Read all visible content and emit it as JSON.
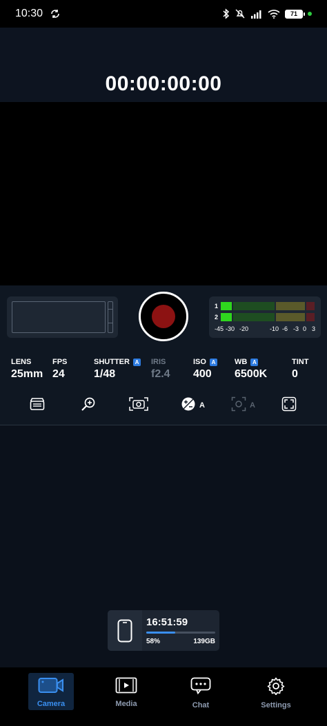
{
  "status_bar": {
    "time": "10:30",
    "battery": "71",
    "colors": {
      "dot": "#2ecc40"
    }
  },
  "timecode": "00:00:00:00",
  "record": {
    "color": "#8c1212"
  },
  "audio": {
    "channels": [
      "1",
      "2"
    ],
    "levels": [
      0.35,
      0.35
    ],
    "scale": [
      "-45",
      "-30",
      "-20",
      "-10",
      "-6",
      "-3",
      "0",
      "3"
    ]
  },
  "params": [
    {
      "label": "LENS",
      "value": "25mm",
      "auto": false,
      "dim": false
    },
    {
      "label": "FPS",
      "value": "24",
      "auto": false,
      "dim": false
    },
    {
      "label": "SHUTTER",
      "value": "1/48",
      "auto": true,
      "dim": false
    },
    {
      "label": "IRIS",
      "value": "f2.4",
      "auto": false,
      "dim": true
    },
    {
      "label": "ISO",
      "value": "400",
      "auto": true,
      "dim": false
    },
    {
      "label": "WB",
      "value": "6500K",
      "auto": true,
      "dim": false
    },
    {
      "label": "TINT",
      "value": "0",
      "auto": false,
      "dim": false
    }
  ],
  "auto_badge": "A",
  "tools": [
    {
      "icon": "clapperboard-icon",
      "label": ""
    },
    {
      "icon": "zoom-in-icon",
      "label": ""
    },
    {
      "icon": "focus-camera-icon",
      "label": ""
    },
    {
      "icon": "exposure-icon",
      "label": "A"
    },
    {
      "icon": "auto-focus-icon",
      "label": "A"
    },
    {
      "icon": "frame-guide-icon",
      "label": ""
    }
  ],
  "storage": {
    "time": "16:51:59",
    "percent": "58%",
    "percent_value": 0.42,
    "size": "139GB"
  },
  "nav": [
    {
      "label": "Camera",
      "icon": "camera-icon",
      "active": true
    },
    {
      "label": "Media",
      "icon": "media-icon",
      "active": false
    },
    {
      "label": "Chat",
      "icon": "chat-icon",
      "active": false
    },
    {
      "label": "Settings",
      "icon": "gear-icon",
      "active": false
    }
  ],
  "colors": {
    "accent": "#3a8ff0",
    "background": "#0b111b"
  }
}
